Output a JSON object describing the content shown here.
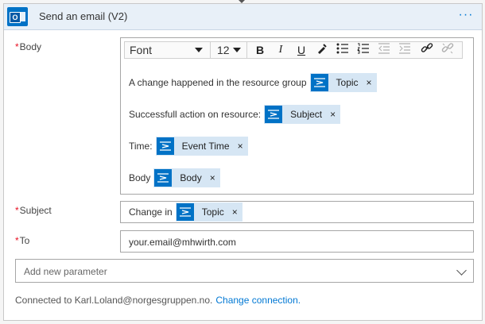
{
  "header": {
    "title": "Send an email (V2)",
    "more_label": "···"
  },
  "body_field": {
    "label": "Body",
    "required_mark": "*",
    "toolbar": {
      "font": "Font",
      "size": "12",
      "bold": "B",
      "italic": "I",
      "underline": "U"
    },
    "lines": [
      {
        "text": "A change happened in the resource group",
        "token": "Topic"
      },
      {
        "text": "Successfull action on resource:",
        "token": "Subject"
      },
      {
        "text": "Time:",
        "token": "Event Time"
      },
      {
        "text": "Body",
        "token": "Body"
      }
    ]
  },
  "subject_field": {
    "label": "Subject",
    "required_mark": "*",
    "text": "Change in",
    "token": "Topic"
  },
  "to_field": {
    "label": "To",
    "required_mark": "*",
    "value": "your.email@mhwirth.com"
  },
  "add_param": {
    "placeholder": "Add new parameter"
  },
  "footer": {
    "connected_text": "Connected to Karl.Loland@norgesgruppen.no.",
    "change_link": "Change connection."
  },
  "token_remove": "×",
  "colors": {
    "accent": "#0078d4",
    "header_bg": "#e8f0f8",
    "token_bg": "#d6e6f4",
    "icon_bg": "#0072c6",
    "required": "#e81123"
  }
}
